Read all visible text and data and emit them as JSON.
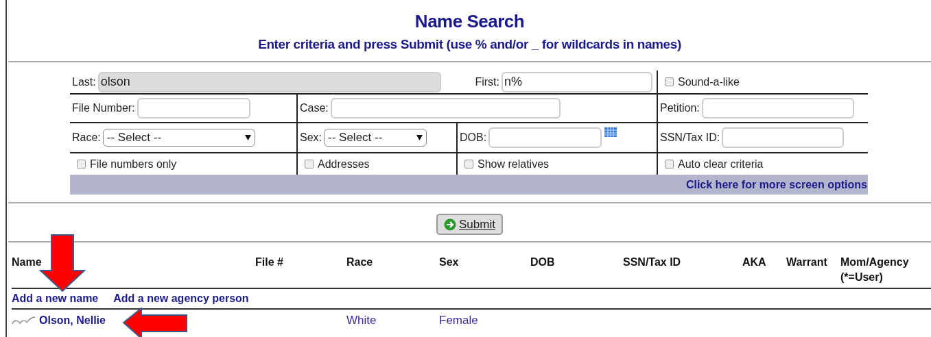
{
  "title": "Name Search",
  "subtitle": "Enter criteria and press Submit (use % and/or _ for wildcards in names)",
  "form": {
    "rows": [
      [
        {
          "kind": "text",
          "label": "Last:",
          "value": "olson",
          "highlighted": true
        },
        {
          "kind": "text",
          "label": "First:",
          "value": "n%",
          "highlighted": false
        },
        {
          "kind": "checkbox",
          "label": "Sound-a-like",
          "checked": false
        }
      ],
      [
        {
          "kind": "text",
          "label": "File Number:",
          "highlighted": false
        },
        {
          "kind": "text",
          "label": "Case:",
          "highlighted": false
        },
        {
          "kind": "text",
          "label": "Petition:",
          "highlighted": false
        }
      ],
      [
        {
          "kind": "select",
          "label": "Race:",
          "value": "-- Select --"
        },
        {
          "kind": "select",
          "label": "Sex:",
          "value": "-- Select --"
        },
        {
          "kind": "date",
          "label": "DOB:"
        },
        {
          "kind": "text",
          "label": "SSN/Tax ID:",
          "highlighted": false
        }
      ],
      [
        {
          "kind": "checkbox",
          "label": "File numbers only",
          "checked": false
        },
        {
          "kind": "checkbox",
          "label": "Addresses",
          "checked": false
        },
        {
          "kind": "checkbox",
          "label": "Show relatives",
          "checked": false
        },
        {
          "kind": "checkbox",
          "label": "Auto clear criteria",
          "checked": false
        }
      ]
    ],
    "more_options_link": "Click here for more screen options"
  },
  "submit_button": {
    "label": "Submit"
  },
  "results": {
    "columns": [
      "Name",
      "File #",
      "Race",
      "Sex",
      "DOB",
      "SSN/Tax ID",
      "AKA",
      "Warrant",
      "Mom/Agency (*=User)"
    ],
    "actions": [
      "Add a new name",
      "Add a new agency person"
    ],
    "rows": [
      {
        "name": "Olson, Nellie",
        "race": "White",
        "sex": "Female"
      }
    ]
  }
}
